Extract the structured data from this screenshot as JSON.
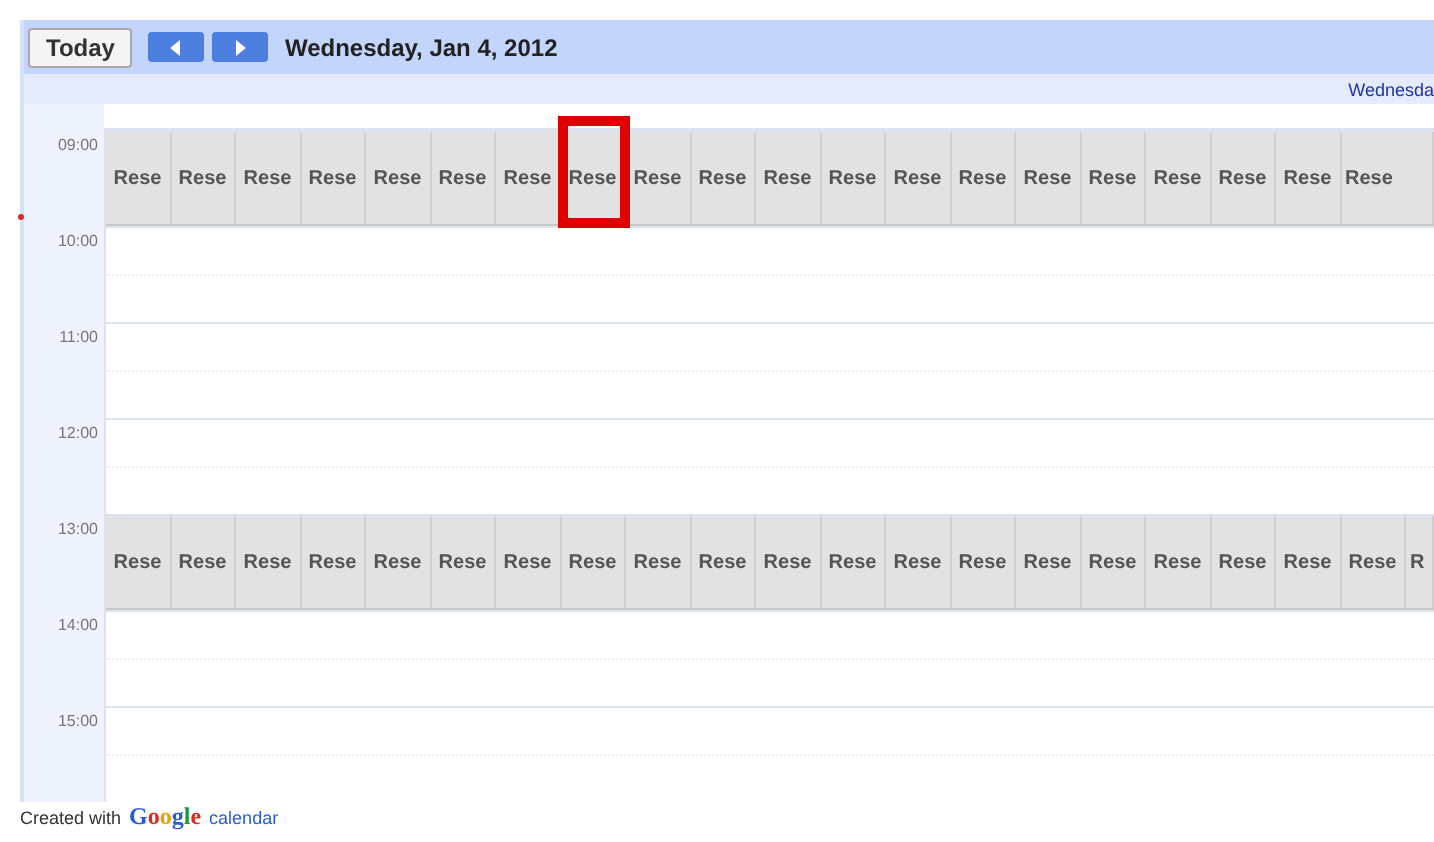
{
  "toolbar": {
    "today_button": "Today",
    "title": "Wednesday, Jan 4, 2012"
  },
  "day_header": "Wednesda",
  "hours": [
    {
      "label": "09:00",
      "events": [
        {
          "title": "Rese",
          "highlighted": false
        },
        {
          "title": "Rese",
          "highlighted": false
        },
        {
          "title": "Rese",
          "highlighted": false
        },
        {
          "title": "Rese",
          "highlighted": false
        },
        {
          "title": "Rese",
          "highlighted": false
        },
        {
          "title": "Rese",
          "highlighted": false
        },
        {
          "title": "Rese",
          "highlighted": false
        },
        {
          "title": "Rese",
          "highlighted": true
        },
        {
          "title": "Rese",
          "highlighted": false
        },
        {
          "title": "Rese",
          "highlighted": false
        },
        {
          "title": "Rese",
          "highlighted": false
        },
        {
          "title": "Rese",
          "highlighted": false
        },
        {
          "title": "Rese",
          "highlighted": false
        },
        {
          "title": "Rese",
          "highlighted": false
        },
        {
          "title": "Rese",
          "highlighted": false
        },
        {
          "title": "Rese",
          "highlighted": false
        },
        {
          "title": "Rese",
          "highlighted": false
        },
        {
          "title": "Rese",
          "highlighted": false
        },
        {
          "title": "Rese",
          "highlighted": false
        },
        {
          "title": "Rese",
          "highlighted": false
        }
      ]
    },
    {
      "label": "10:00"
    },
    {
      "label": "11:00"
    },
    {
      "label": "12:00"
    },
    {
      "label": "13:00",
      "events": [
        {
          "title": "Rese",
          "highlighted": false
        },
        {
          "title": "Rese",
          "highlighted": false
        },
        {
          "title": "Rese",
          "highlighted": false
        },
        {
          "title": "Rese",
          "highlighted": false
        },
        {
          "title": "Rese",
          "highlighted": false
        },
        {
          "title": "Rese",
          "highlighted": false
        },
        {
          "title": "Rese",
          "highlighted": false
        },
        {
          "title": "Rese",
          "highlighted": false
        },
        {
          "title": "Rese",
          "highlighted": false
        },
        {
          "title": "Rese",
          "highlighted": false
        },
        {
          "title": "Rese",
          "highlighted": false
        },
        {
          "title": "Rese",
          "highlighted": false
        },
        {
          "title": "Rese",
          "highlighted": false
        },
        {
          "title": "Rese",
          "highlighted": false
        },
        {
          "title": "Rese",
          "highlighted": false
        },
        {
          "title": "Rese",
          "highlighted": false
        },
        {
          "title": "Rese",
          "highlighted": false
        },
        {
          "title": "Rese",
          "highlighted": false
        },
        {
          "title": "Rese",
          "highlighted": false
        },
        {
          "title": "Rese",
          "highlighted": false
        },
        {
          "title": "R",
          "highlighted": false
        }
      ]
    },
    {
      "label": "14:00"
    },
    {
      "label": "15:00"
    }
  ],
  "now_marker": true,
  "footer": {
    "text": "Created with",
    "brand": "Google",
    "product": "calendar"
  }
}
